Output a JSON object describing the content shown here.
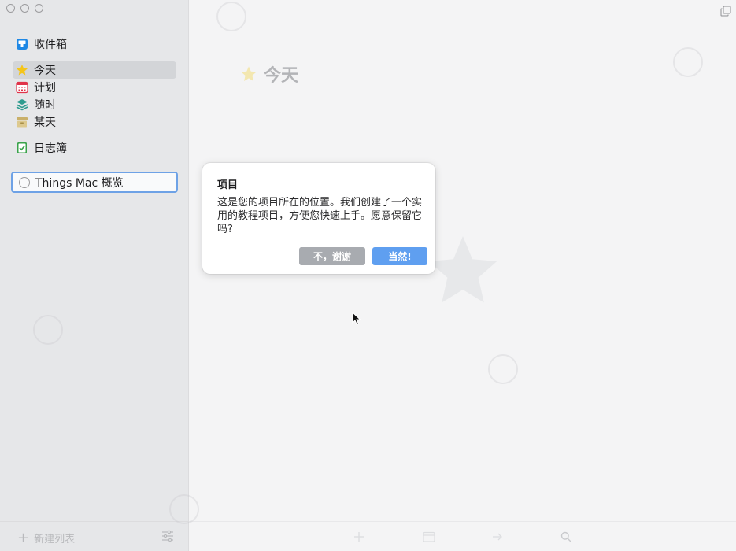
{
  "sidebar": {
    "items": [
      {
        "label": "收件箱",
        "icon": "inbox-icon",
        "color": "#1e88e5"
      },
      {
        "label": "今天",
        "icon": "star-icon",
        "color": "#f5c518",
        "selected": true
      },
      {
        "label": "计划",
        "icon": "calendar-icon",
        "color": "#e0334a"
      },
      {
        "label": "随时",
        "icon": "layers-icon",
        "color": "#2f9c8f"
      },
      {
        "label": "某天",
        "icon": "archive-box-icon",
        "color": "#c9b06a"
      },
      {
        "label": "日志簿",
        "icon": "logbook-icon",
        "color": "#3aa34b"
      }
    ],
    "project_name": "Things Mac 概览",
    "footer": {
      "new_list_label": "新建列表"
    }
  },
  "main": {
    "title": "今天"
  },
  "popover": {
    "title": "项目",
    "body": "这是您的项目所在的位置。我们创建了一个实用的教程项目，方便您快速上手。愿意保留它吗?",
    "decline_label": "不，谢谢",
    "accept_label": "当然!"
  },
  "colors": {
    "accent": "#5f9ff0",
    "sidebar_bg": "#e6e7e9",
    "main_bg": "#f4f4f5"
  }
}
